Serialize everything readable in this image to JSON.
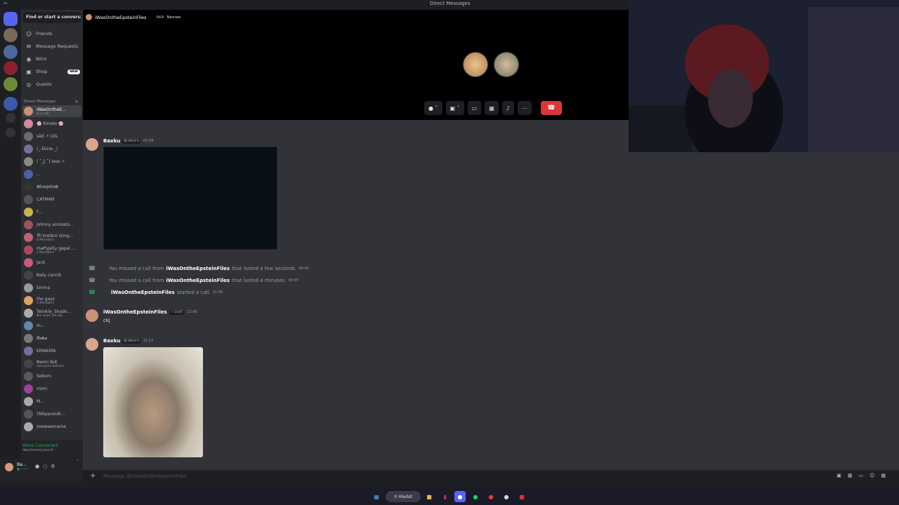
{
  "window": {
    "title": "Direct Messages"
  },
  "sidebar": {
    "search_placeholder": "Find or start a conversati...",
    "nav": [
      {
        "label": "Friends",
        "icon": "friends-icon"
      },
      {
        "label": "Message Requests",
        "icon": "envelope-icon"
      },
      {
        "label": "Nitro",
        "icon": "nitro-icon"
      },
      {
        "label": "Shop",
        "icon": "shop-icon",
        "badge": "NEW"
      },
      {
        "label": "Quests",
        "icon": "quests-icon"
      }
    ],
    "dm_header": "Direct Messages",
    "dms": [
      {
        "name": "iWasOntheE...",
        "sub": "In a call",
        "color": "#c9907a"
      },
      {
        "name": "🌸 Kinoko 🌸",
        "sub": "",
        "color": "#d18a9a"
      },
      {
        "name": "sâd  ↗ LOL",
        "sub": "",
        "color": "#6b6b6b"
      },
      {
        "name": "(_-Dixie-_)",
        "sub": "",
        "color": "#7a6aa0"
      },
      {
        "name": "( ͡˘ ͜ʖ ͡˘) tess ✧",
        "sub": "",
        "color": "#888"
      },
      {
        "name": "...",
        "sub": "",
        "color": "#4b5fa8"
      },
      {
        "name": "✿bagete✿",
        "sub": "",
        "color": "#333"
      },
      {
        "name": "CATMAN",
        "sub": "",
        "color": "#555"
      },
      {
        "name": "F...",
        "sub": "",
        "color": "#c8b44a"
      },
      {
        "name": "Johnny animato...",
        "sub": "",
        "color": "#a05060"
      },
      {
        "name": "Tři kreténi (king...",
        "sub": "4 Members",
        "color": "#c06070"
      },
      {
        "name": "maPyjeSy gapel ...",
        "sub": "4 Members",
        "color": "#b04858"
      },
      {
        "name": "Jack",
        "sub": "",
        "color": "#c85a7a"
      },
      {
        "name": "Naty cancik",
        "sub": "",
        "color": "#444"
      },
      {
        "name": "Emma",
        "sub": "",
        "color": "#999"
      },
      {
        "name": "the gays",
        "sub": "2 Members",
        "color": "#e0a060"
      },
      {
        "name": "Twinkle_Shado...",
        "sub": "Nie mam juž siły",
        "color": "#aaa"
      },
      {
        "name": "m...",
        "sub": "",
        "color": "#5a8ab0"
      },
      {
        "name": "𝑹𝒐𝒃𝒐",
        "sub": "",
        "color": "#777"
      },
      {
        "name": "KIRAKIRA",
        "sub": "",
        "color": "#7a6aa0"
      },
      {
        "name": "Neoni Bot",
        "sub": "everyone behave.",
        "color": "#444"
      },
      {
        "name": "Sebom",
        "sub": "",
        "color": "#5a5a5a"
      },
      {
        "name": "mimi",
        "sub": "",
        "color": "#a040a0"
      },
      {
        "name": "M...",
        "sub": "",
        "color": "#aaa"
      },
      {
        "name": "YNSpaceUK...",
        "sub": "",
        "color": "#555"
      },
      {
        "name": "zooweemama",
        "sub": "",
        "color": "#aaa"
      }
    ],
    "voice": {
      "status": "Voice Connected",
      "channel": "iWasOntheEpsteinFi..."
    },
    "user": {
      "name": "Ba...",
      "status": "● f + t"
    }
  },
  "call": {
    "name": "iWasOntheEpsteinFiles",
    "aka_label": "AKA",
    "aka_name": "Neoree"
  },
  "messages": [
    {
      "author": "Baxku",
      "tag": "😺 NEOFU",
      "time": "03:09"
    },
    {
      "author": "iWasOntheEpsteinFiles",
      "tag": "✧ GOAT",
      "time": "11:06",
      "text": "ckj"
    },
    {
      "author": "Baxku",
      "tag": "😺 NEOFU",
      "time": "11:17"
    }
  ],
  "system": [
    {
      "pre": "You missed a call from",
      "who": "iWasOntheEpsteinFiles",
      "post": "that lasted a few seconds.",
      "time": "09:45"
    },
    {
      "pre": "You missed a call from",
      "who": "iWasOntheEpsteinFiles",
      "post": "that lasted 4 minutes.",
      "time": "09:55"
    },
    {
      "pre": "",
      "who": "iWasOntheEpsteinFiles",
      "post": "started a call.",
      "time": "11:05"
    }
  ],
  "input": {
    "placeholder": "Message @iWasOntheEpsteinFiles"
  },
  "taskbar": {
    "search": "Hledat"
  }
}
